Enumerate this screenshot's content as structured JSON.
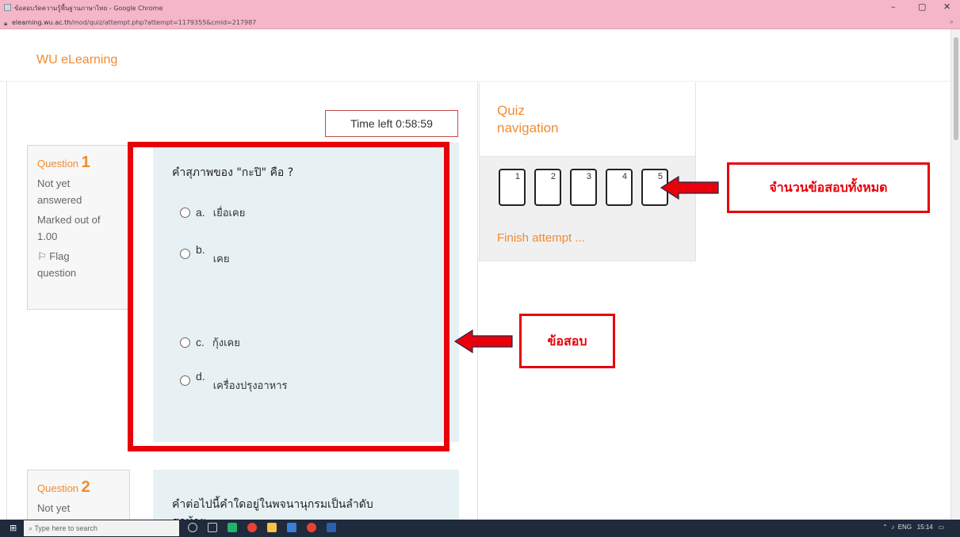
{
  "browser": {
    "title": "ข้อสอบวัดความรู้พื้นฐานภาษาไทย - Google Chrome",
    "url_host": "elearning.wu.ac.th",
    "url_path": "/mod/quiz/attempt.php?attempt=1179355&cmid=217987",
    "minimize": "–",
    "maximize": "▢",
    "close": "✕"
  },
  "site": {
    "brand": "WU eLearning"
  },
  "quiz": {
    "timer": "Time left 0:58:59",
    "questions": [
      {
        "label": "Question",
        "number": "1",
        "status_line1": "Not yet",
        "status_line2": "answered",
        "marks_line1": "Marked out of",
        "marks_line2": "1.00",
        "flag_line1": "Flag",
        "flag_line2": "question",
        "text": "คำสุภาพของ \"กะปิ\" คือ ?",
        "options": [
          {
            "letter": "a.",
            "text": "เยื่อเคย"
          },
          {
            "letter": "b.",
            "text": "เคย"
          },
          {
            "letter": "c.",
            "text": "กุ้งเคย"
          },
          {
            "letter": "d.",
            "text": "เครื่องปรุงอาหาร"
          }
        ]
      },
      {
        "label": "Question",
        "number": "2",
        "status_line1": "Not yet",
        "text_line1": "คำต่อไปนี้คำใดอยู่ในพจนานุกรมเป็นลำดับ",
        "text_line2": "สุดท้าย"
      }
    ]
  },
  "navigation": {
    "title_line1": "Quiz",
    "title_line2": "navigation",
    "buttons": [
      "1",
      "2",
      "3",
      "4",
      "5"
    ],
    "finish": "Finish attempt ..."
  },
  "annotations": {
    "total_questions": "จำนวนข้อสอบทั้งหมด",
    "exam": "ข้อสอบ",
    "color": "#e8000a"
  },
  "taskbar": {
    "search_placeholder": "Type here to search",
    "tray_lang": "ENG",
    "time": "15:14"
  }
}
